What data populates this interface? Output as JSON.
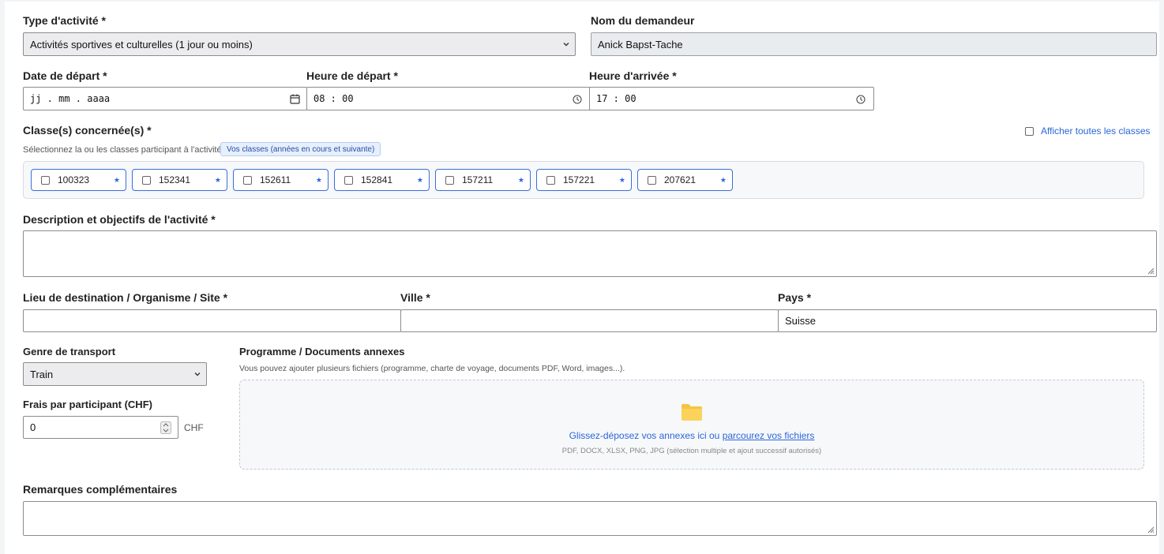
{
  "activity_type": {
    "label": "Type d'activité *",
    "value": "Activités sportives et culturelles (1 jour ou moins)"
  },
  "requester": {
    "label": "Nom du demandeur",
    "value": "Anick Bapst-Tache"
  },
  "departure_date": {
    "label": "Date de départ *",
    "value": "jj . mm . aaaa"
  },
  "departure_time": {
    "label": "Heure de départ *",
    "value": "08 : 00"
  },
  "arrival_time": {
    "label": "Heure d'arrivée *",
    "value": "17 : 00"
  },
  "classes": {
    "label": "Classe(s) concernée(s) *",
    "hint": "Sélectionnez la ou les classes participant à l'activité",
    "badge": "Vos classes (années en cours et suivante)",
    "show_all_label": "Afficher toutes les classes",
    "items": [
      "100323",
      "152341",
      "152611",
      "152841",
      "157211",
      "157221",
      "207621"
    ]
  },
  "description": {
    "label": "Description et objectifs de l'activité *",
    "value": ""
  },
  "destination": {
    "label": "Lieu de destination / Organisme / Site *",
    "value": ""
  },
  "city": {
    "label": "Ville *",
    "value": ""
  },
  "country": {
    "label": "Pays *",
    "value": "Suisse"
  },
  "transport": {
    "label": "Genre de transport",
    "value": "Train"
  },
  "fees": {
    "label": "Frais par participant (CHF)",
    "value": "0",
    "unit": "CHF"
  },
  "documents": {
    "label": "Programme / Documents annexes",
    "hint": "Vous pouvez ajouter plusieurs fichiers (programme, charte de voyage, documents PDF, Word, images...).",
    "drop_text": "Glissez-déposez vos annexes ici ou",
    "browse_link": "parcourez vos fichiers",
    "formats": "PDF, DOCX, XLSX, PNG, JPG (sélection multiple et ajout successif autorisés)"
  },
  "remarks": {
    "label": "Remarques complémentaires",
    "value": ""
  },
  "colors": {
    "accent": "#2a66d9",
    "folder": "#f6c343"
  }
}
